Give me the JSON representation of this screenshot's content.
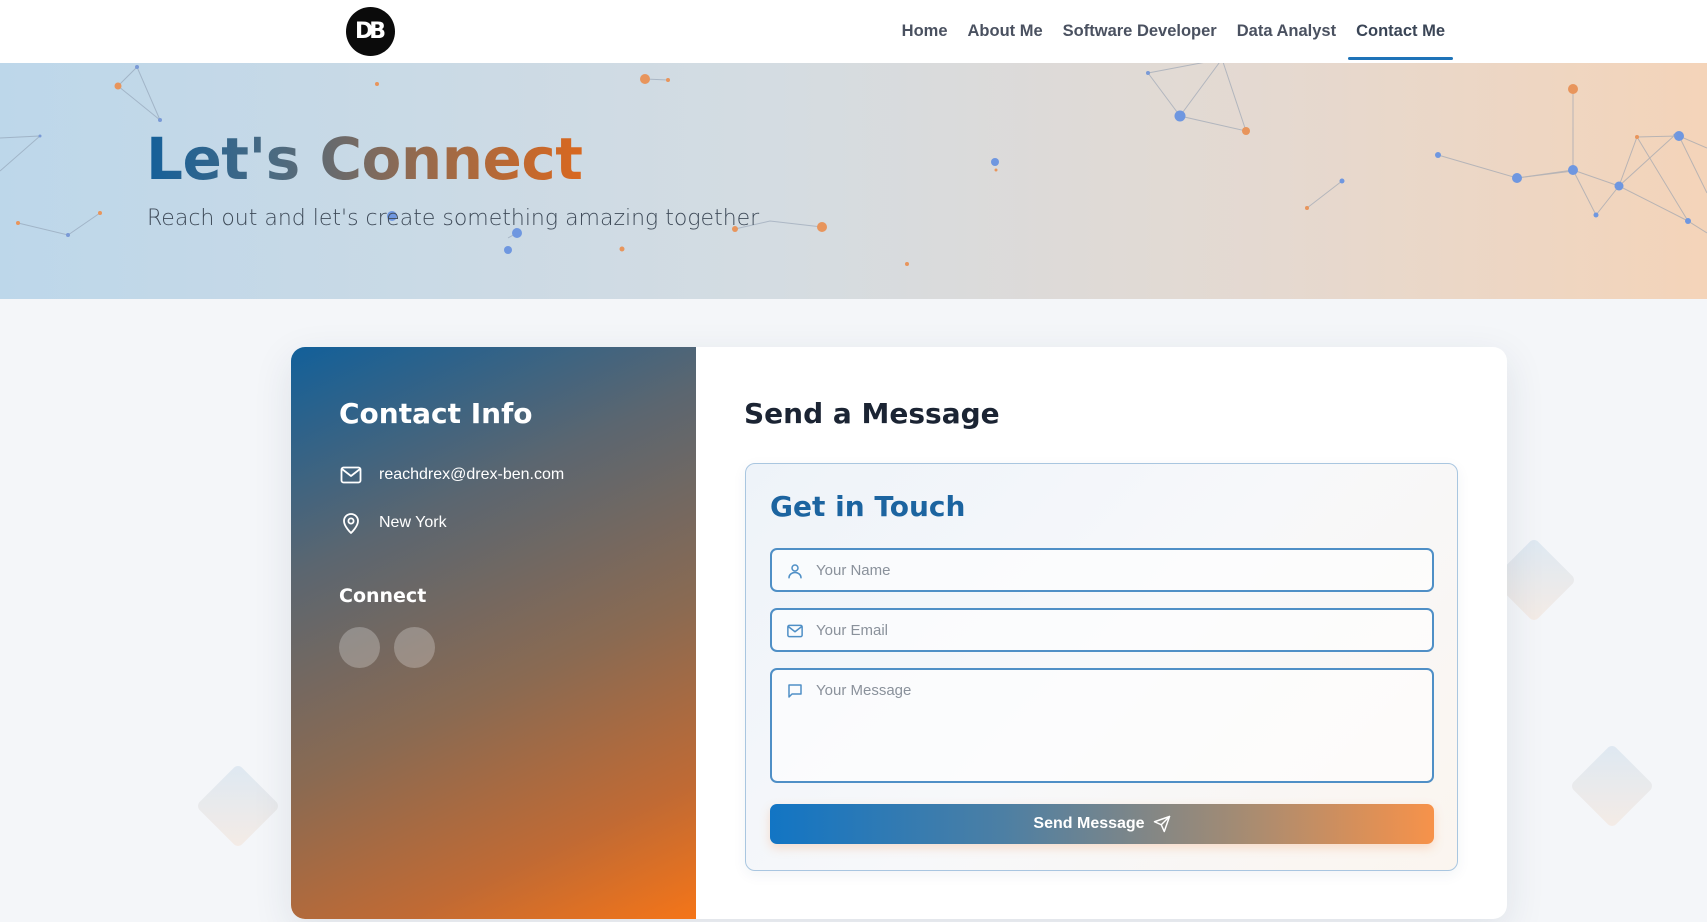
{
  "nav": {
    "logo_text": "DB",
    "links": [
      {
        "label": "Home"
      },
      {
        "label": "About Me"
      },
      {
        "label": "Software Developer"
      },
      {
        "label": "Data Analyst"
      },
      {
        "label": "Contact Me",
        "active": true
      }
    ]
  },
  "hero": {
    "title": "Let's Connect",
    "subtitle": "Reach out and let's create something amazing together"
  },
  "contact_info": {
    "heading": "Contact Info",
    "email": "reachdrex@drex-ben.com",
    "location": "New York",
    "connect_heading": "Connect",
    "icons": {
      "email": "mail-icon",
      "location": "map-pin-icon"
    }
  },
  "message": {
    "heading": "Send a Message",
    "form_heading": "Get in Touch",
    "name_placeholder": "Your Name",
    "email_placeholder": "Your Email",
    "message_placeholder": "Your Message",
    "submit_label": "Send Message",
    "icons": {
      "name": "user-icon",
      "email": "mail-icon",
      "message": "chat-bubble-icon",
      "submit": "send-icon"
    }
  },
  "colors": {
    "accent_blue": "#1e73b8",
    "accent_orange": "#f57518"
  }
}
